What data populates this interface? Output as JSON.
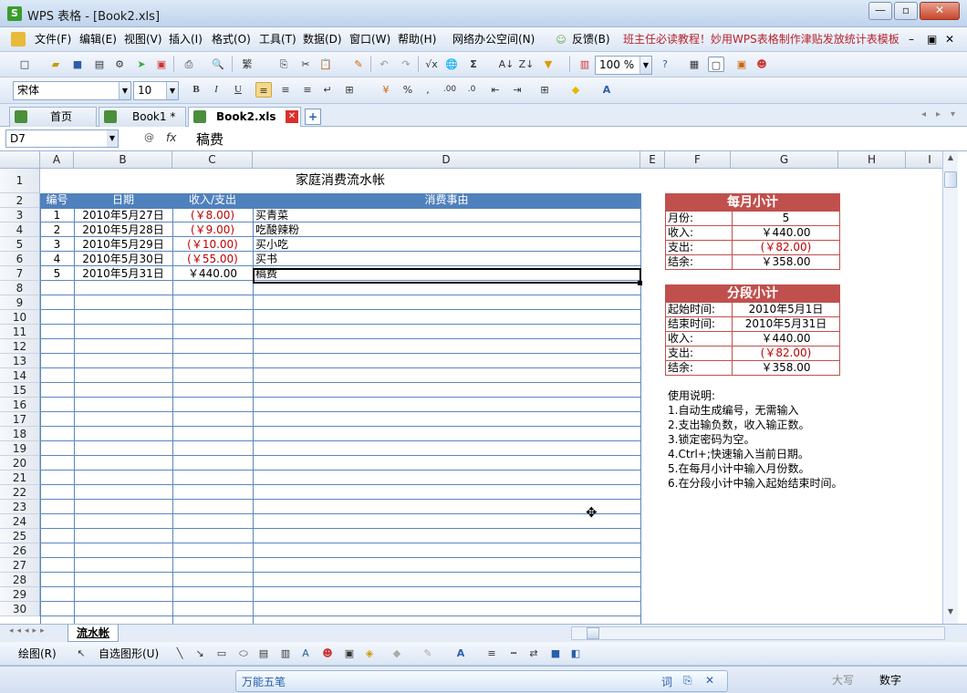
{
  "window": {
    "title": "WPS 表格 - [Book2.xls]",
    "logo": "S",
    "minimize": "—",
    "restore": "▫",
    "close": "✕"
  },
  "menu": {
    "items": [
      "文件(F)",
      "编辑(E)",
      "视图(V)",
      "插入(I)",
      "格式(O)",
      "工具(T)",
      "数据(D)",
      "窗口(W)",
      "帮助(H)",
      "网络办公空间(N)",
      "反馈(B)"
    ],
    "ad_text": "班主任必读教程！妙用WPS表格制作津贴发放统计表模板"
  },
  "toolbar": {
    "zoom": "100 %",
    "font_name": "宋体",
    "font_size": "10"
  },
  "tabs": [
    {
      "label": "首页"
    },
    {
      "label": "Book1 *"
    },
    {
      "label": "Book2.xls"
    }
  ],
  "formula_bar": {
    "name_box": "D7",
    "fx": "fx",
    "value": "稿费"
  },
  "columns": [
    "A",
    "B",
    "C",
    "D",
    "E",
    "F",
    "G",
    "H",
    "I"
  ],
  "rows": [
    "1",
    "2",
    "3",
    "4",
    "5",
    "6",
    "7",
    "8",
    "9",
    "10",
    "11",
    "12",
    "13",
    "14",
    "15",
    "16",
    "17",
    "18",
    "19",
    "20",
    "21",
    "22",
    "23",
    "24",
    "25",
    "26",
    "27",
    "28",
    "29",
    "30"
  ],
  "sheet": {
    "title": "家庭消费流水帐",
    "headers": [
      "编号",
      "日期",
      "收入/支出",
      "消费事由"
    ],
    "records": [
      {
        "id": "1",
        "date": "2010年5月27日",
        "amount": "(￥8.00)",
        "reason": "买青菜",
        "negative": true
      },
      {
        "id": "2",
        "date": "2010年5月28日",
        "amount": "(￥9.00)",
        "reason": "吃酸辣粉",
        "negative": true
      },
      {
        "id": "3",
        "date": "2010年5月29日",
        "amount": "(￥10.00)",
        "reason": "买小吃",
        "negative": true
      },
      {
        "id": "4",
        "date": "2010年5月30日",
        "amount": "(￥55.00)",
        "reason": "买书",
        "negative": true
      },
      {
        "id": "5",
        "date": "2010年5月31日",
        "amount": "￥440.00",
        "reason": "稿费",
        "negative": false
      }
    ]
  },
  "monthly_summary": {
    "title": "每月小计",
    "rows": [
      {
        "label": "月份:",
        "value": "5"
      },
      {
        "label": "收入:",
        "value": "￥440.00"
      },
      {
        "label": "支出:",
        "value": "(￥82.00)"
      },
      {
        "label": "结余:",
        "value": "￥358.00"
      }
    ]
  },
  "period_summary": {
    "title": "分段小计",
    "rows": [
      {
        "label": "起始时间:",
        "value": "2010年5月1日"
      },
      {
        "label": "结束时间:",
        "value": "2010年5月31日"
      },
      {
        "label": "收入:",
        "value": "￥440.00"
      },
      {
        "label": "支出:",
        "value": "(￥82.00)"
      },
      {
        "label": "结余:",
        "value": "￥358.00"
      }
    ]
  },
  "instructions": {
    "title": "使用说明:",
    "items": [
      "1.自动生成编号，无需输入",
      "2.支出输负数，收入输正数。",
      "3.锁定密码为空。",
      "4.Ctrl+;快速输入当前日期。",
      "5.在每月小计中输入月份数。",
      "6.在分段小计中输入起始结束时间。"
    ]
  },
  "sheet_tab": "流水帐",
  "drawbar": {
    "draw_label": "绘图(R)",
    "autoshape_label": "自选图形(U)"
  },
  "ime": {
    "label": "万能五笔",
    "btn1": "词"
  },
  "status": {
    "caps": "大写",
    "num": "数字"
  }
}
